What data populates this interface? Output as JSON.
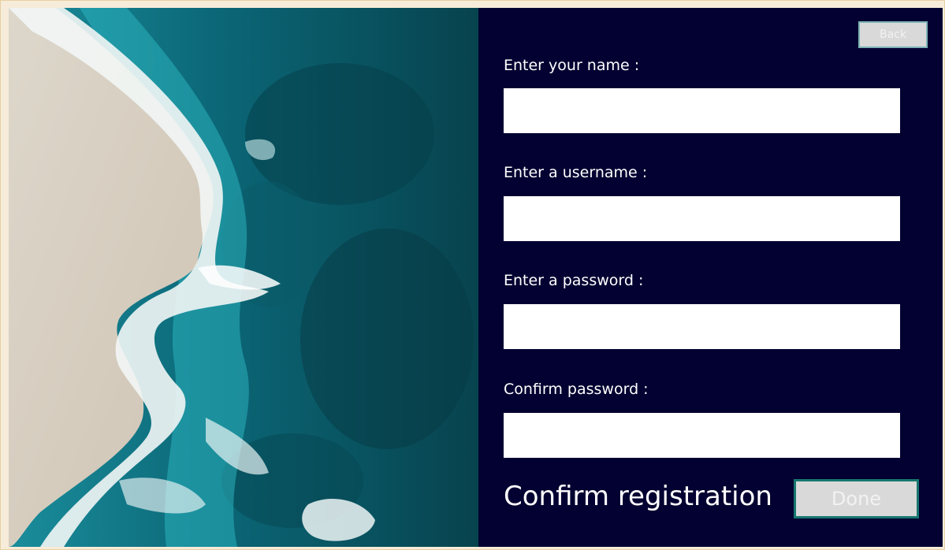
{
  "back_button": {
    "label": "Back"
  },
  "fields": [
    {
      "label": "Enter your name :",
      "value": ""
    },
    {
      "label": "Enter a username :",
      "value": ""
    },
    {
      "label": "Enter a password :",
      "value": ""
    },
    {
      "label": "Confirm password :",
      "value": ""
    }
  ],
  "confirm": {
    "text": "Confirm registration",
    "button_label": "Done"
  },
  "colors": {
    "panel_background": "#030131",
    "button_background": "#d9d9d9",
    "done_border": "#17776f",
    "back_border": "#7fb3b7"
  }
}
